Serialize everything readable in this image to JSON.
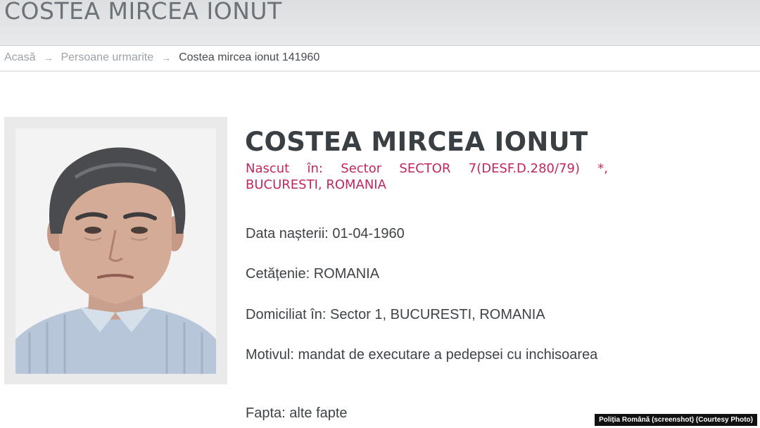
{
  "header": {
    "title": "COSTEA MIRCEA IONUT"
  },
  "breadcrumb": {
    "home": "Acasă",
    "section": "Persoane urmarite",
    "separator": "→",
    "current": "Costea mircea ionut 141960"
  },
  "profile": {
    "name": "COSTEA MIRCEA IONUT",
    "birthplace": "Nascut în: Sector SECTOR 7(DESF.D.280/79) *, BUCURESTI, ROMANIA",
    "birth_date_label": "Data nașterii:",
    "birth_date": "01-04-1960",
    "citizenship_label": "Cetățenie:",
    "citizenship": "ROMANIA",
    "domicile_label": "Domiciliat în:",
    "domicile": "Sector 1, BUCURESTI, ROMANIA",
    "reason_label": "Motivul:",
    "reason": "mandat de executare a pedepsei cu inchisoarea",
    "deed_label": "Fapta:",
    "deed": "alte fapte"
  },
  "credit": "Poliția Română (screenshot) (Courtesy Photo)",
  "colors": {
    "birthplace_accent": "#c1275f",
    "header_band": "#e2e3e4",
    "text": "#3e4347"
  }
}
